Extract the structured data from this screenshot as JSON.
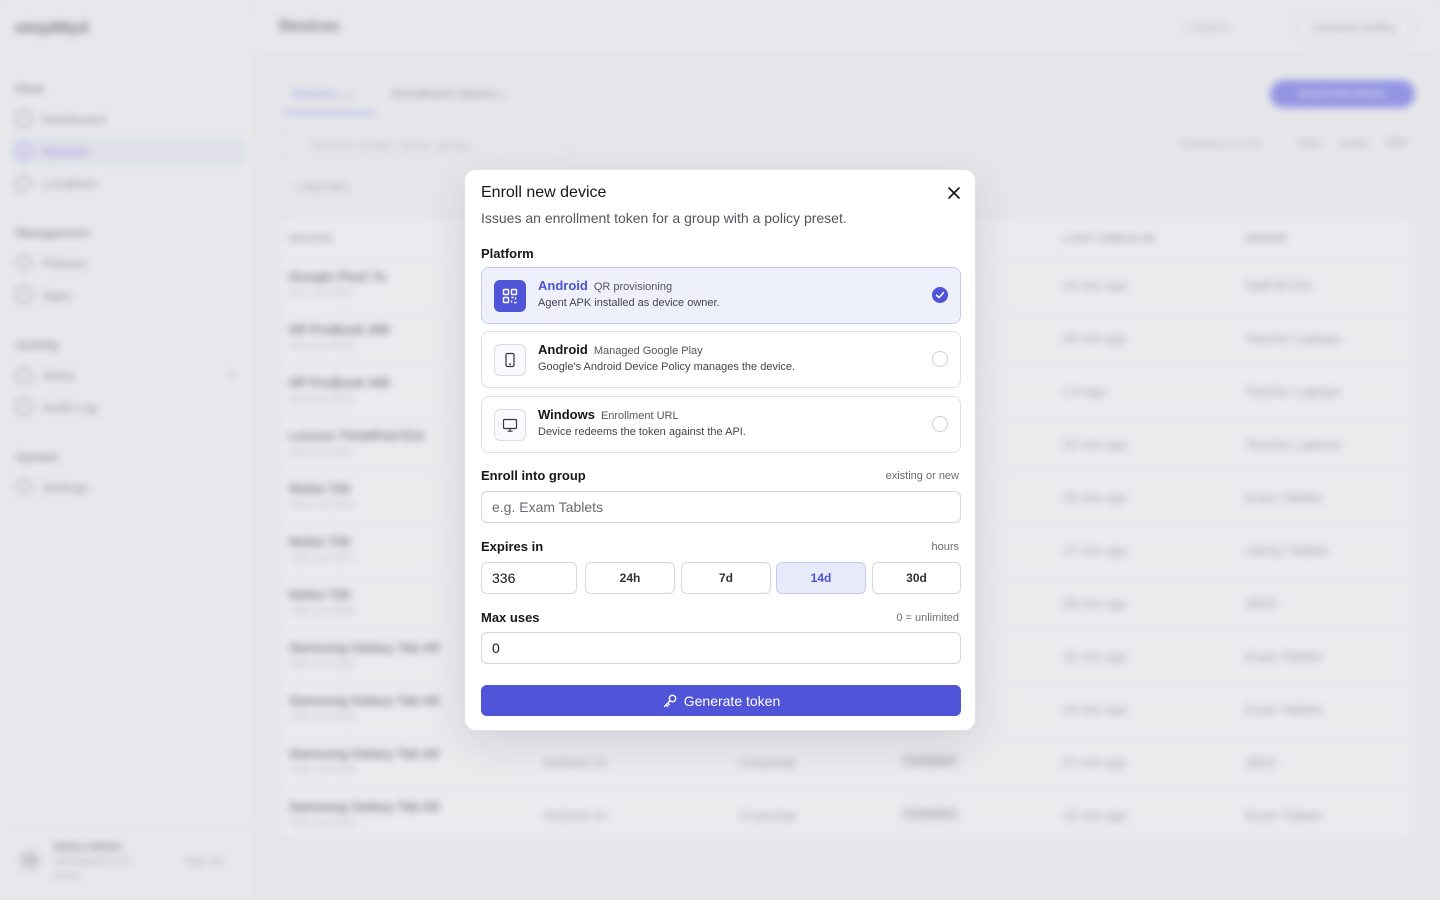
{
  "background": {
    "logo": "simplMyd",
    "sidebar": {
      "sections": [
        {
          "title": "Fleet",
          "items": [
            {
              "label": "Dashboard"
            },
            {
              "label": "Devices",
              "active": true
            },
            {
              "label": "Locations"
            }
          ]
        },
        {
          "title": "Management",
          "items": [
            {
              "label": "Policies"
            },
            {
              "label": "Apps"
            }
          ]
        },
        {
          "title": "Activity",
          "items": [
            {
              "label": "Alerts",
              "count": "0"
            },
            {
              "label": "Audit Log"
            }
          ]
        },
        {
          "title": "System",
          "items": [
            {
              "label": "Settings"
            }
          ]
        }
      ],
      "user": {
        "initials": "DA",
        "name": "Demo Admin",
        "email": "admin@demo.sh...",
        "org": "Demo",
        "signout": "Sign out"
      }
    },
    "topbar": {
      "title": "Devices",
      "search": "Search",
      "gateway": "Gateway healthy"
    },
    "tabs": [
      {
        "label": "Devices",
        "count": "11"
      },
      {
        "label": "Enrollment tokens",
        "count": "3"
      }
    ],
    "enroll_button": "Enroll new device",
    "search_placeholder": "Search model, serial, group...",
    "showing": "Showing 11 of 11",
    "export": [
      "CSV",
      "XLSX",
      "PDF"
    ],
    "add_filter": "Add filter",
    "table": {
      "headers": [
        "DEVICE",
        "LAST CHECK-IN",
        "GROUP"
      ],
      "rows": [
        {
          "model": "Google Pixel 7a",
          "serial": "#01-LXA-0822",
          "os": "",
          "own": "",
          "status": "",
          "checkin": "25 min ago",
          "group": "Staff BYOD"
        },
        {
          "model": "HP ProBook 440",
          "serial": "#09-LXA-0919",
          "os": "",
          "own": "",
          "status": "",
          "checkin": "29 min ago",
          "group": "Teacher Laptops"
        },
        {
          "model": "HP ProBook 440",
          "serial": "#09-LXA-0910",
          "os": "",
          "own": "",
          "status": "",
          "checkin": "2 d ago",
          "group": "Teacher Laptops"
        },
        {
          "model": "Lenovo ThinkPad E14",
          "serial": "#05-LXA-0902",
          "os": "",
          "own": "",
          "status": "",
          "checkin": "22 min ago",
          "group": "Teacher Laptops"
        },
        {
          "model": "Nokia T20",
          "serial": "TAB-LXA-0500",
          "os": "",
          "own": "",
          "status": "",
          "checkin": "25 min ago",
          "group": "Exam Tablets"
        },
        {
          "model": "Nokia T20",
          "serial": "TAB-LXA-0507",
          "os": "",
          "own": "",
          "status": "",
          "checkin": "27 min ago",
          "group": "Library Tablets"
        },
        {
          "model": "Nokia T20",
          "serial": "TAB-LXA-0589",
          "os": "",
          "own": "",
          "status": "",
          "checkin": "38 min ago",
          "group": "JEE3"
        },
        {
          "model": "Samsung Galaxy Tab A9",
          "serial": "TAB-LXA-0563",
          "os": "",
          "own": "",
          "status": "",
          "checkin": "22 min ago",
          "group": "Exam Tablets"
        },
        {
          "model": "Samsung Galaxy Tab A9",
          "serial": "TAB-LXA-0565",
          "os": "",
          "own": "",
          "status": "",
          "checkin": "24 min ago",
          "group": "Exam Tablets"
        },
        {
          "model": "Samsung Galaxy Tab A9",
          "serial": "TAB-LXA-0539",
          "os": "Android 14",
          "own": "Corporate",
          "status": "Compliant",
          "checkin": "27 min ago",
          "group": "JEE3"
        },
        {
          "model": "Samsung Galaxy Tab A9",
          "serial": "TAB-LXA-0544",
          "os": "Android 14",
          "own": "Corporate",
          "status": "Compliant",
          "checkin": "22 min ago",
          "group": "Exam Tablets"
        }
      ]
    }
  },
  "modal": {
    "title": "Enroll new device",
    "subtitle": "Issues an enrollment token for a group with a policy preset.",
    "platform_label": "Platform",
    "options": [
      {
        "name": "Android",
        "tag": "QR provisioning",
        "desc": "Agent APK installed as device owner.",
        "icon": "qr-code-icon",
        "selected": true
      },
      {
        "name": "Android",
        "tag": "Managed Google Play",
        "desc": "Google's Android Device Policy manages the device.",
        "icon": "smartphone-icon",
        "selected": false
      },
      {
        "name": "Windows",
        "tag": "Enrollment URL",
        "desc": "Device redeems the token against the API.",
        "icon": "monitor-icon",
        "selected": false
      }
    ],
    "group_label": "Enroll into group",
    "group_hint": "existing or new",
    "group_placeholder": "e.g. Exam Tablets",
    "group_value": "",
    "expires_label": "Expires in",
    "expires_hint": "hours",
    "expires_value": "336",
    "expires_presets": [
      {
        "label": "24h",
        "active": false
      },
      {
        "label": "7d",
        "active": false
      },
      {
        "label": "14d",
        "active": true
      },
      {
        "label": "30d",
        "active": false
      }
    ],
    "max_uses_label": "Max uses",
    "max_uses_hint": "0 = unlimited",
    "max_uses_value": "0",
    "submit_label": "Generate token",
    "colors": {
      "accent": "#4f54d9",
      "accent_text": "#4b50d4",
      "selected_bg": "#eef0fc"
    }
  }
}
